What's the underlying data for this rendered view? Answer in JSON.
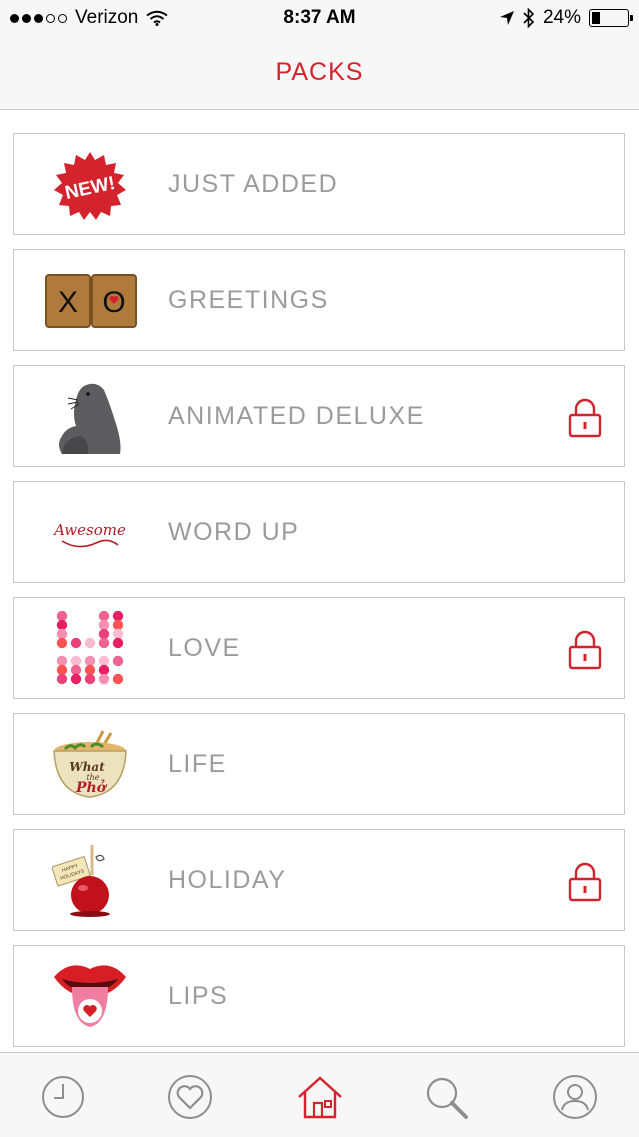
{
  "status_bar": {
    "carrier": "Verizon",
    "time": "8:37 AM",
    "battery_percent": "24%",
    "battery_level": 0.24
  },
  "header": {
    "title": "PACKS"
  },
  "packs": [
    {
      "label": "JUST ADDED",
      "thumb": "new-badge-icon",
      "locked": false,
      "badge_text": "NEW!"
    },
    {
      "label": "GREETINGS",
      "thumb": "scrabble-xo-tiles",
      "locked": false,
      "tile_letters": [
        "X",
        "O"
      ]
    },
    {
      "label": "ANIMATED DELUXE",
      "thumb": "seal-sticker",
      "locked": true
    },
    {
      "label": "WORD UP",
      "thumb": "awesome-script-sticker",
      "locked": false,
      "sticker_text": "Awesome"
    },
    {
      "label": "LOVE",
      "thumb": "flower-love-letters",
      "locked": true
    },
    {
      "label": "LIFE",
      "thumb": "pho-bowl-sticker",
      "locked": false,
      "sticker_text": [
        "What",
        "the",
        "Phở"
      ]
    },
    {
      "label": "HOLIDAY",
      "thumb": "candy-apple-sticker",
      "locked": true,
      "sticker_text": [
        "HAPPY",
        "HOLIDAYS"
      ]
    },
    {
      "label": "LIPS",
      "thumb": "lips-tongue-heart-sticker",
      "locked": false
    }
  ],
  "tab_bar": [
    {
      "name": "recent",
      "icon": "clock-icon",
      "active": false
    },
    {
      "name": "favorites",
      "icon": "heart-icon",
      "active": true
    },
    {
      "name": "home",
      "icon": "home-icon",
      "active": true
    },
    {
      "name": "search",
      "icon": "search-icon",
      "active": false
    },
    {
      "name": "profile",
      "icon": "profile-icon",
      "active": false
    }
  ],
  "colors": {
    "accent": "#d4232c",
    "label": "#9b9b9b",
    "border": "#c8c8c8",
    "tab_icon": "#8e8e8e"
  }
}
